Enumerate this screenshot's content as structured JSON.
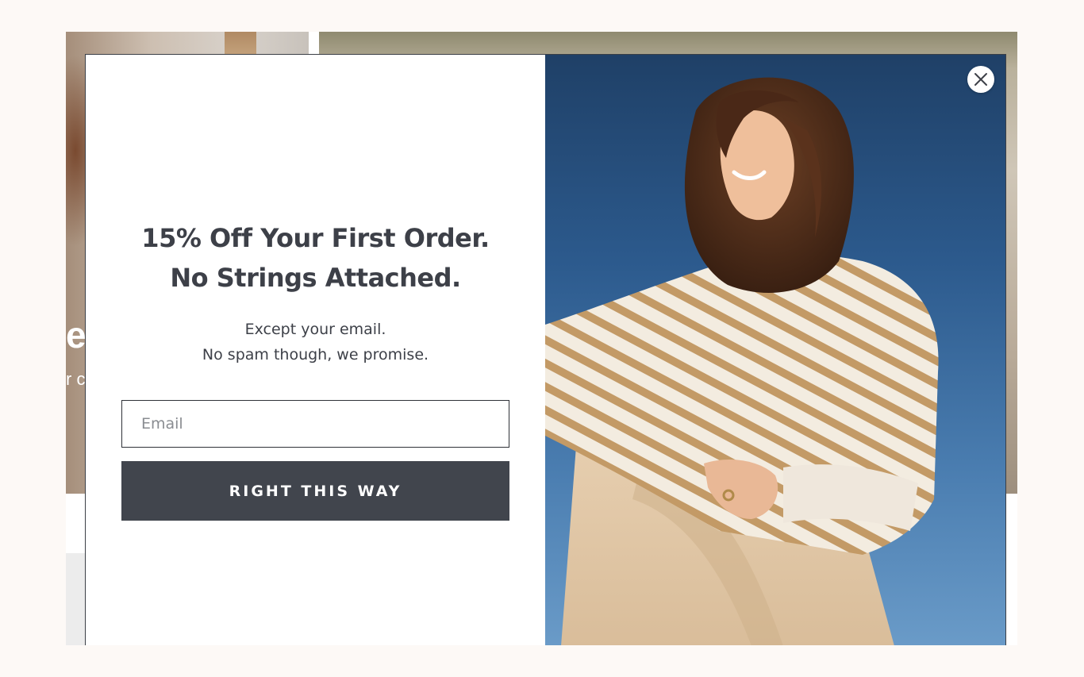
{
  "background_page": {
    "hero_partial_title": "e",
    "hero_partial_subtitle": "r c"
  },
  "modal": {
    "headline_line1": "15% Off Your First Order.",
    "headline_line2": "No Strings Attached.",
    "subtext_line1": "Except your email.",
    "subtext_line2": "No spam though, we promise.",
    "email_placeholder": "Email",
    "email_value": "",
    "submit_label": "RIGHT THIS WAY",
    "close_icon": "close-icon",
    "colors": {
      "button_bg": "#41454d",
      "text": "#3d4048",
      "sky": "#2c5a8d"
    }
  }
}
